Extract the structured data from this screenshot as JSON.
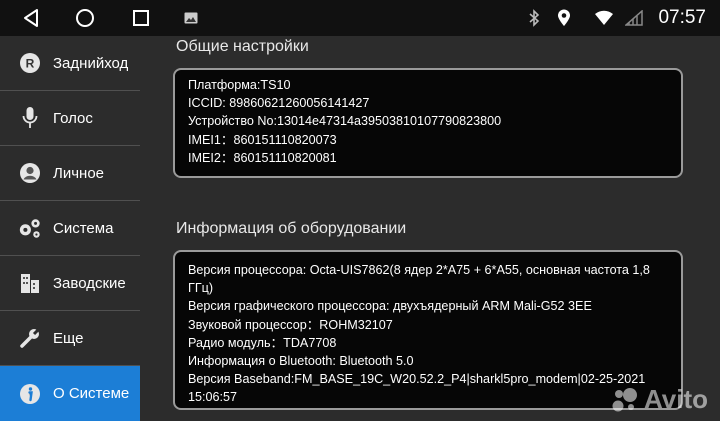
{
  "status_bar": {
    "time": "07:57",
    "icons": [
      "back-icon",
      "home-icon",
      "recents-icon",
      "gallery-icon",
      "bluetooth-icon",
      "location-icon",
      "wifi-icon",
      "signal-icon"
    ]
  },
  "sidebar": {
    "items": [
      {
        "label": "Заднийход",
        "icon": "rear-camera-icon",
        "active": false
      },
      {
        "label": "Голос",
        "icon": "microphone-icon",
        "active": false
      },
      {
        "label": "Личное",
        "icon": "user-icon",
        "active": false
      },
      {
        "label": "Система",
        "icon": "gears-icon",
        "active": false
      },
      {
        "label": "Заводские",
        "icon": "factory-icon",
        "active": false
      },
      {
        "label": "Еще",
        "icon": "wrench-icon",
        "active": false
      },
      {
        "label": "О Системе",
        "icon": "info-icon",
        "active": true
      }
    ]
  },
  "general": {
    "title": "Общие настройки",
    "rows": [
      "Платформа:TS10",
      "ICCID:  89860621260056141427",
      "Устройство No:13014e47314a39503810107790823800",
      "IMEI1：860151110820073",
      "IMEI2：860151110820081"
    ]
  },
  "hardware": {
    "title": "Информация об оборудовании",
    "rows": [
      "Версия процессора:  Octa-UIS7862(8 ядер 2*A75 + 6*A55, основная частота 1,8 ГГц)",
      "Версия графического процессора: двухъядерный ARM Mali-G52 3EE",
      "Звуковой процессор：ROHM32107",
      "Радио модуль：TDA7708",
      "Информация о Bluetooth: Bluetooth 5.0",
      "Версия Baseband:FM_BASE_19C_W20.52.2_P4|sharkl5pro_modem|02-25-2021 15:06:57"
    ]
  },
  "watermark": {
    "text": "Avito"
  },
  "colors": {
    "accent": "#1c7ed6",
    "background": "#2c2c2c",
    "panel": "#060606",
    "panel_border": "#9a9a9a"
  }
}
